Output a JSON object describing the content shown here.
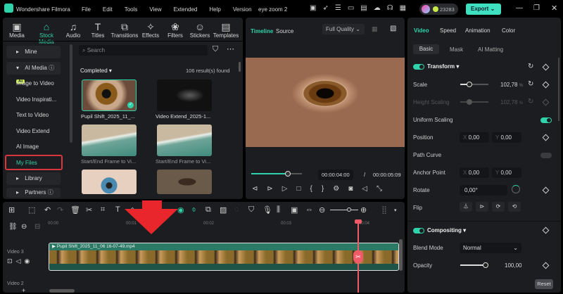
{
  "app": {
    "title": "Wondershare Filmora",
    "project": "eye zoom 2",
    "menu": [
      "File",
      "Edit",
      "Tools",
      "View",
      "Extended",
      "Help",
      "Version"
    ],
    "credits": "23283",
    "export": "Export"
  },
  "colors": {
    "accent": "#2fd3a9",
    "highlight": "#e03a3e",
    "playhead": "#ef5b67"
  },
  "toolbar": [
    "Media",
    "Stock Media",
    "Audio",
    "Titles",
    "Transitions",
    "Effects",
    "Filters",
    "Stickers",
    "Templates"
  ],
  "sidebar": {
    "mine": "Mine",
    "ai_media": "AI Media",
    "ai_badge": "AI",
    "items": [
      "Image to Video",
      "Video Inspirati...",
      "Text to Video",
      "Video Extend",
      "AI Image",
      "My Files"
    ],
    "library": "Library",
    "partners": "Partners"
  },
  "browser": {
    "search_placeholder": "Search",
    "filter": "Completed",
    "results": "106 result(s) found",
    "items": [
      "Pupil Shift_2025_11_...",
      "Video Extend_2025-1...",
      "Start/End Frame to Vi...",
      "Start/End Frame to Vi...",
      "",
      ""
    ]
  },
  "preview": {
    "tabs": [
      "Timeline",
      "Source"
    ],
    "quality": "Full Quality",
    "current": "00:00:04:00",
    "sep": "/",
    "total": "00:00:05:09",
    "progress": 0.72
  },
  "inspector": {
    "tabs": [
      "Video",
      "Speed",
      "Animation",
      "Color"
    ],
    "subtabs": [
      "Basic",
      "Mask",
      "AI Matting"
    ],
    "transform": "Transform",
    "scale_label": "Scale",
    "scale": "102,78",
    "pct": "%",
    "height_label": "Height Scaling",
    "height": "102,78",
    "uniform": "Uniform Scaling",
    "position": "Position",
    "x": "X",
    "y": "Y",
    "pos_x": "0,00",
    "pos_y": "0,00",
    "path": "Path Curve",
    "anchor": "Anchor Point",
    "anc_x": "0,00",
    "anc_y": "0,00",
    "rotate": "Rotate",
    "rotate_val": "0,00°",
    "flip": "Flip",
    "compositing": "Compositing",
    "blend_label": "Blend Mode",
    "blend": "Normal",
    "opacity_label": "Opacity",
    "opacity": "100,00",
    "reset": "Reset"
  },
  "timeline": {
    "ticks": [
      "00:00",
      "00:01",
      "00:02",
      "00:03",
      "00:04"
    ],
    "track3": "Video 3",
    "track2": "Video 2",
    "clip": "Pupil Shift_2025_11_06 16-07-49.mp4"
  }
}
